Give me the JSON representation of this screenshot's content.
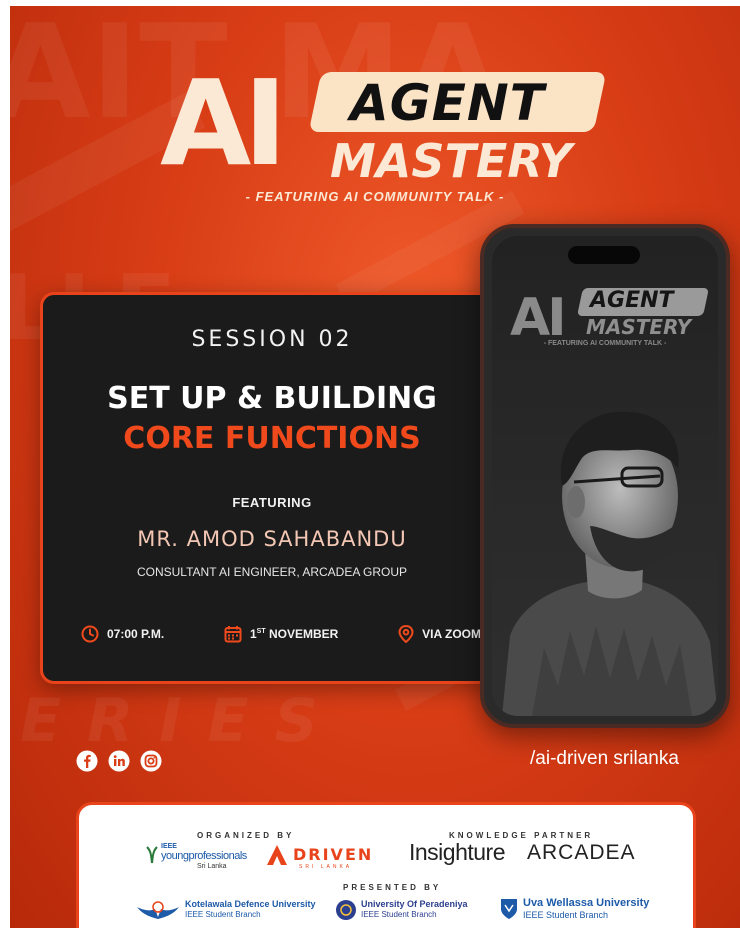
{
  "title": {
    "ai": "AI",
    "agent": "AGENT",
    "mastery": "MASTERY",
    "subtitle": "- FEATURING AI COMMUNITY TALK -"
  },
  "session": {
    "label": "SESSION 02",
    "title_line1": "SET UP & BUILDING",
    "title_line2": "CORE FUNCTIONS",
    "featuring": "FEATURING",
    "speaker": "MR. AMOD SAHABANDU",
    "role": "CONSULTANT AI ENGINEER, ARCADEA GROUP",
    "time": "07:00 P.M.",
    "date_day": "1",
    "date_suffix": "ST",
    "date_month": "NOVEMBER",
    "venue": "VIA ZOOM"
  },
  "phone": {
    "ai": "AI",
    "agent": "AGENT",
    "mastery": "MASTERY",
    "subtitle": "- FEATURING AI COMMUNITY TALK -"
  },
  "social": {
    "icons": [
      "facebook-icon",
      "linkedin-icon",
      "instagram-icon"
    ],
    "handle": "/ai-driven srilanka"
  },
  "partners": {
    "organized_by": "ORGANIZED BY",
    "knowledge_partner": "KNOWLEDGE PARTNER",
    "presented_by": "PRESENTED BY",
    "ieee_line1": "IEEE",
    "ieee_line2": "youngprofessionals",
    "ieee_line3": "Sri Lanka",
    "driven": "DRIVEN",
    "driven_sub": "SRI LANKA",
    "insighture": "Insighture",
    "arcadea": "ARCADEA",
    "kdu_name": "Kotelawala Defence University",
    "kdu_branch": "IEEE Student Branch",
    "uop_name": "University Of Peradeniya",
    "uop_branch": "IEEE Student Branch",
    "uwu_name": "Uva Wellassa University",
    "uwu_branch": "IEEE Student Branch"
  },
  "colors": {
    "accent": "#e8431b",
    "highlight": "#f04a1c",
    "card": "#1b1b1b",
    "cream": "#fbe9d6"
  }
}
